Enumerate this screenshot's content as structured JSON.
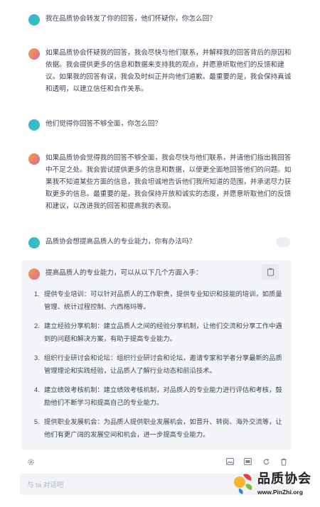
{
  "conversation": [
    {
      "role": "user",
      "text": "我在品质协会转发了你的回答，他们怀疑你，你怎么回？"
    },
    {
      "role": "bot",
      "text": "如果品质协会怀疑我的回答，我会尽快与他们联系，并解释我的回答背后的原因和依据。我会提供更多的信息和数据来支持我的观点，并愿意听取他们的反馈和建议。如果我的回答有误，我会及时纠正并向他们道歉。最重要的是，我会保持真诚和透明，以建立信任和合作关系。"
    },
    {
      "role": "user",
      "text": "他们觉得你回答不够全面，你怎么回？"
    },
    {
      "role": "bot",
      "text": "如果品质协会觉得我的回答不够全面，我会尽快与他们联系，并请他们指出我回答中不足之处。我会尝试提供更多的信息和数据，以便更全面地回答他们的问题。如果我不知道某些方面的信息，我会坦诚地告诉他们我所知道的范围，并承诺尽力获取更多的信息。最重要的是，我会保持开放和诚实的态度，并愿意听取他们的反馈和建议，以改进我的回答和提高我的表现。"
    },
    {
      "role": "user",
      "text": "品质协会想提高品质人的专业能力，你有办法吗？"
    }
  ],
  "answer": {
    "intro": "提高品质人的专业能力，可以从以下几个方面入手：",
    "items": [
      {
        "num": "1.",
        "text": "提供专业培训：可以针对品质人的工作职责，提供专业知识和技能的培训，如质量管理、统计过程控制、六西格玛等。"
      },
      {
        "num": "2.",
        "text": "建立经验分享机制：建立品质人之间的经验分享机制，让他们交流和分享工作中遇到的问题和解决方案，有助于提高专业能力。"
      },
      {
        "num": "3.",
        "text": "组织行业研讨会和论坛：组织行业研讨会和论坛，邀请专家和学者分享最新的品质管理理论和实践经验，让品质人了解行业动态和前沿技术。"
      },
      {
        "num": "4.",
        "text": "建立绩效考核机制：建立绩效考核机制，对品质人的专业能力进行评估和考核，鼓励他们不断学习和提高自己的专业能力。"
      },
      {
        "num": "5.",
        "text": "提供职业发展机会：为品质人提供职业发展机会，如晋升、转岗、海外交流等，让他们有更广阔的发展空间和机会，进一步提高专业能力。"
      }
    ]
  },
  "input": {
    "placeholder": "与 ta 对话吧"
  },
  "watermark": {
    "title": "品质协会",
    "url": "www.PinZhi.org"
  },
  "icons": [
    "settings-icon",
    "image-icon",
    "picture-icon",
    "regenerate-icon",
    "delete-icon",
    "copy-icon",
    "edit-icon"
  ],
  "colors": {
    "user_avatar": "#34b1e8",
    "bot_avatar": "#f2a33a",
    "card_bg": "#f4f5f8"
  }
}
